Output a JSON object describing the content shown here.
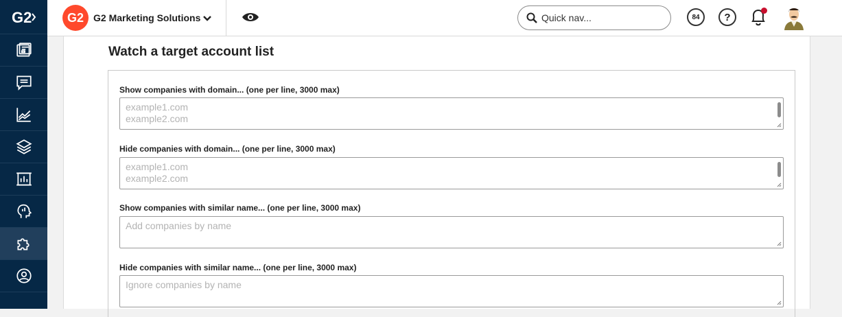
{
  "topbar": {
    "brand_logo_text": "G2",
    "brand_name": "G2 Marketing Solutions",
    "search_placeholder": "Quick nav...",
    "score_value": "84",
    "help_label": "?"
  },
  "sidebar": {
    "logo_text": "G2",
    "items": [
      {
        "icon": "dashboard-icon"
      },
      {
        "icon": "chat-icon"
      },
      {
        "icon": "chart-line-icon"
      },
      {
        "icon": "layers-icon"
      },
      {
        "icon": "report-icon"
      },
      {
        "icon": "head-insight-icon"
      },
      {
        "icon": "puzzle-icon"
      },
      {
        "icon": "user-circle-icon"
      }
    ]
  },
  "main": {
    "title": "Watch a target account list",
    "fields": [
      {
        "label": "Show companies with domain... (one per line, 3000 max)",
        "placeholder_lines": [
          "example1.com",
          "example2.com"
        ]
      },
      {
        "label": "Hide companies with domain... (one per line, 3000 max)",
        "placeholder_lines": [
          "example1.com",
          "example2.com"
        ]
      },
      {
        "label": "Show companies with similar name... (one per line, 3000 max)",
        "placeholder_lines": [
          "Add companies by name"
        ]
      },
      {
        "label": "Hide companies with similar name... (one per line, 3000 max)",
        "placeholder_lines": [
          "Ignore companies by name"
        ]
      }
    ]
  },
  "colors": {
    "sidebar": "#062846",
    "brand": "#ff492c",
    "notification": "#c8102e"
  }
}
